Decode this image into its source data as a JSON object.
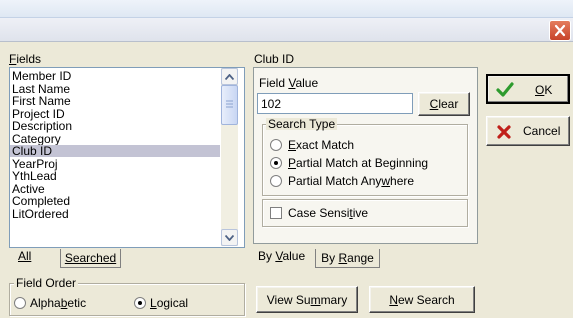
{
  "window": {
    "close_glyph": "✕"
  },
  "fields": {
    "label": "Fields",
    "items": [
      "Member ID",
      "Last Name",
      "First Name",
      "Project ID",
      "Description",
      "Category",
      "Club ID",
      "YearProj",
      "YthLead",
      "Active",
      "Completed",
      "LitOrdered"
    ],
    "selected": "Club ID",
    "tabs": {
      "all": "All",
      "searched": "Searched"
    }
  },
  "field_order": {
    "label": "Field Order",
    "alphabetic": "Alphabetic",
    "logical": "Logical",
    "selected": "logical"
  },
  "search": {
    "field_label": "Club ID",
    "field_value_label": "Field Value",
    "field_value": "102",
    "clear": "Clear",
    "search_type": {
      "label": "Search Type",
      "options": [
        "Exact Match",
        "Partial Match at Beginning",
        "Partial Match Anywhere"
      ],
      "selected": "Partial Match at Beginning"
    },
    "case_sensitive": "Case Sensitive",
    "case_sensitive_checked": false,
    "tabs": {
      "by_value": "By Value",
      "by_range": "By Range"
    },
    "view_summary": "View Summary",
    "new_search": "New Search"
  },
  "actions": {
    "ok": "OK",
    "cancel": "Cancel"
  },
  "colors": {
    "ok_check": "#2e9b2e",
    "cancel_x": "#c0201a",
    "selection": "#c3c3d4"
  }
}
